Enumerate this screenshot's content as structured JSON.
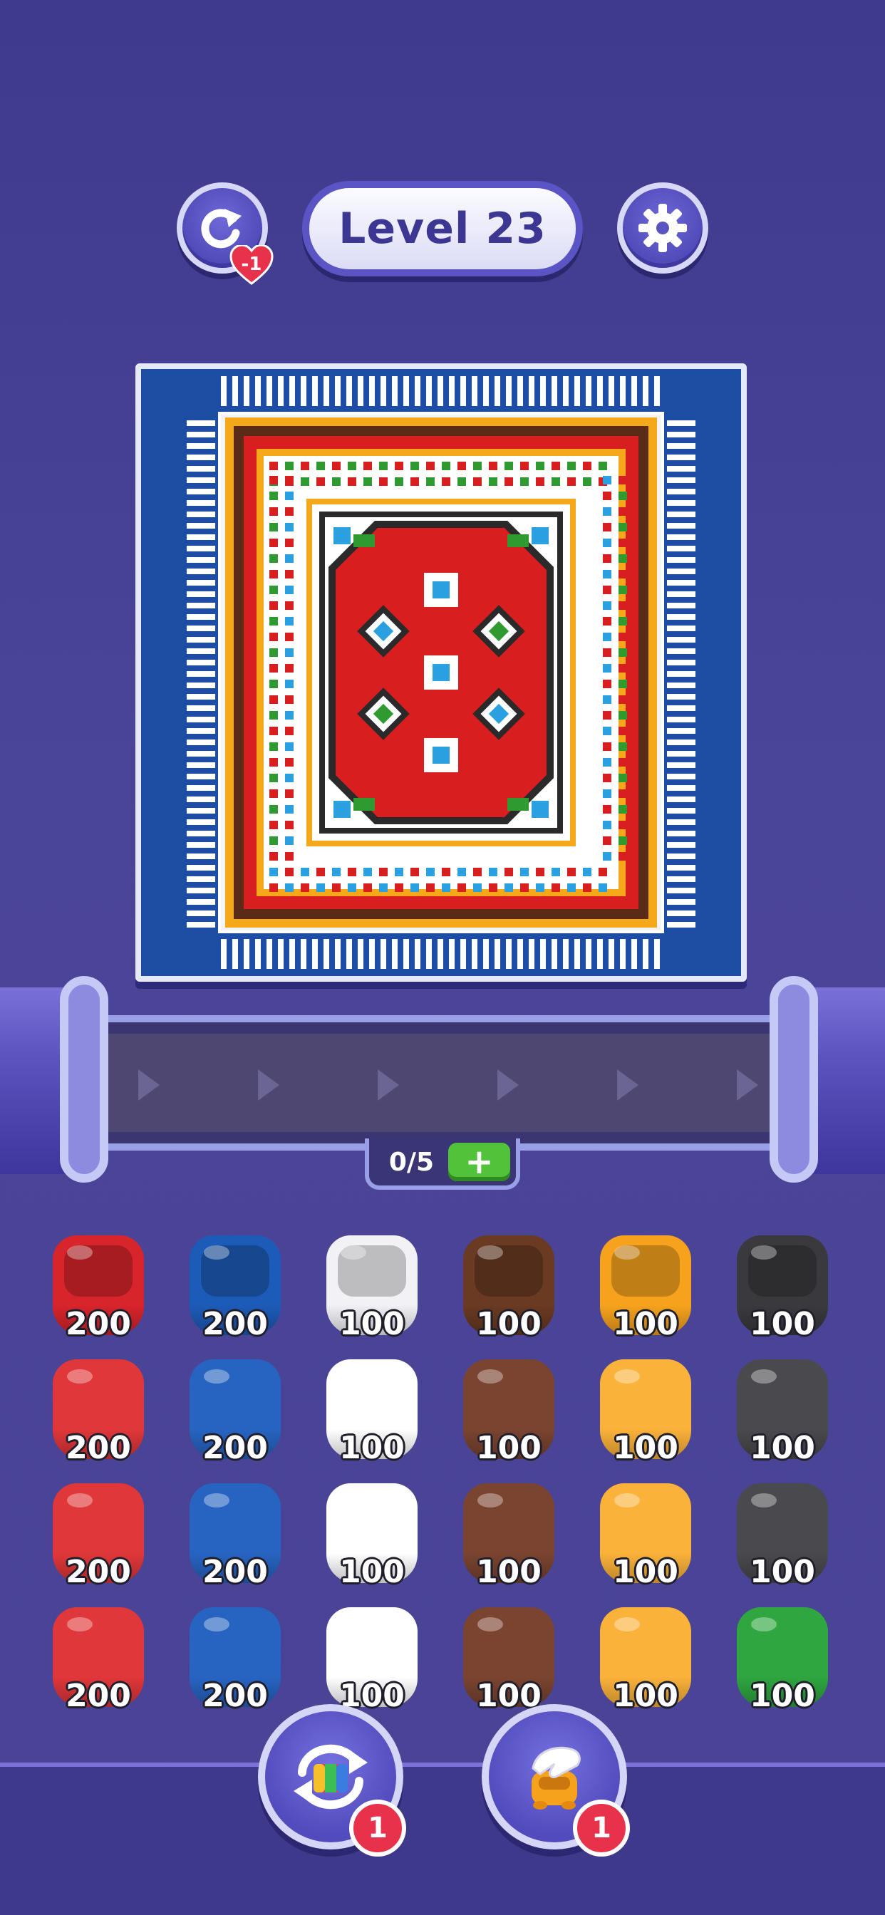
{
  "header": {
    "level_label": "Level 23",
    "undo_cost": "-1",
    "undo_icon": "undo-arrow-icon",
    "settings_icon": "gear-icon"
  },
  "board": {
    "pattern": "pixel carpet with red center medallion, white/yellow/brown borders, blue background and white fringe"
  },
  "conveyor": {
    "capacity": "0/5",
    "add_icon": "plus-icon"
  },
  "cups": [
    [
      {
        "color": "#d7252b",
        "count": "200",
        "open": true
      },
      {
        "color": "#1d5bb8",
        "count": "200",
        "open": true
      },
      {
        "color": "#f2f2f6",
        "count": "100",
        "open": true
      },
      {
        "color": "#6a3a22",
        "count": "100",
        "open": true
      },
      {
        "color": "#f6a21d",
        "count": "100",
        "open": true
      },
      {
        "color": "#3a3a3e",
        "count": "100",
        "open": true
      }
    ],
    [
      {
        "color": "#e0373a",
        "count": "200"
      },
      {
        "color": "#2764c2",
        "count": "200"
      },
      {
        "color": "#ffffff",
        "count": "100"
      },
      {
        "color": "#7a4430",
        "count": "100"
      },
      {
        "color": "#fbb23a",
        "count": "100"
      },
      {
        "color": "#4a4a4e",
        "count": "100"
      }
    ],
    [
      {
        "color": "#e0373a",
        "count": "200"
      },
      {
        "color": "#2764c2",
        "count": "200"
      },
      {
        "color": "#ffffff",
        "count": "100"
      },
      {
        "color": "#7a4430",
        "count": "100"
      },
      {
        "color": "#fbb23a",
        "count": "100"
      },
      {
        "color": "#4a4a4e",
        "count": "100"
      }
    ],
    [
      {
        "color": "#e0373a",
        "count": "200"
      },
      {
        "color": "#2764c2",
        "count": "200"
      },
      {
        "color": "#ffffff",
        "count": "100"
      },
      {
        "color": "#7a4430",
        "count": "100"
      },
      {
        "color": "#fbb23a",
        "count": "100"
      },
      {
        "color": "#2fa640",
        "count": "100"
      }
    ]
  ],
  "powerups": {
    "shuffle": {
      "icon": "shuffle-icon",
      "count": "1"
    },
    "hand": {
      "icon": "hand-pick-icon",
      "count": "1"
    }
  }
}
